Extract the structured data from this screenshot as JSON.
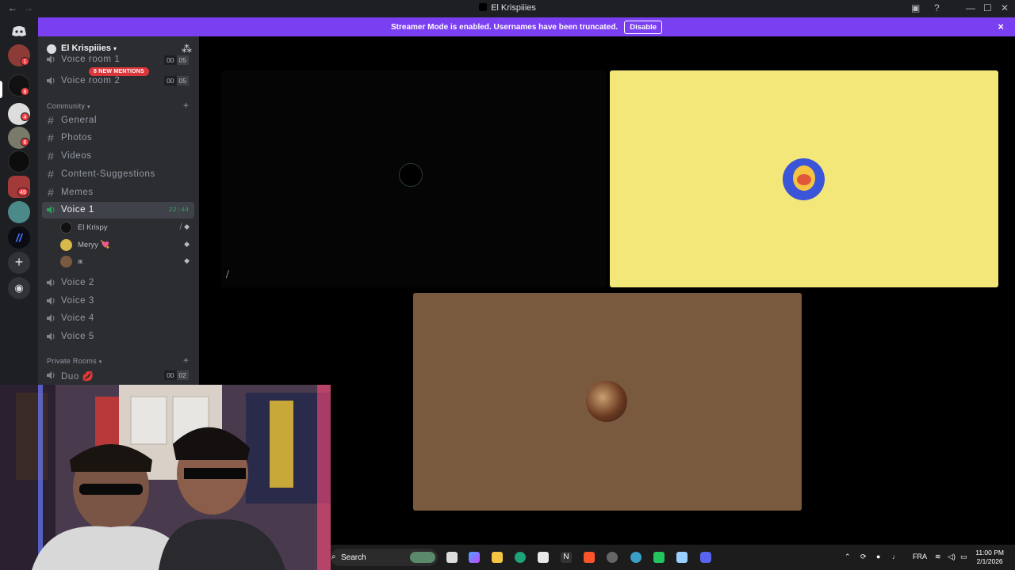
{
  "window": {
    "title": "El Krispiiies",
    "nav_back": "←",
    "nav_forward": "→"
  },
  "banner": {
    "text": "Streamer Mode is enabled. Usernames have been truncated.",
    "button": "Disable",
    "close": "×"
  },
  "server_rail": {
    "badges": [
      "1",
      "8",
      "4",
      "6",
      "49"
    ]
  },
  "guild": {
    "name": "El Krispiiies",
    "mentions_pill": "8 NEW MENTIONS"
  },
  "channels": {
    "voice_rooms": [
      {
        "label": "Voice room 1",
        "count_a": "00",
        "count_b": "05"
      },
      {
        "label": "Voice room 2",
        "count_a": "00",
        "count_b": "05"
      }
    ],
    "community_category": "Community",
    "text_channels": [
      "General",
      "Photos",
      "Videos",
      "Content-Suggestions",
      "Memes"
    ],
    "active_voice": {
      "label": "Voice 1",
      "time": "22:44"
    },
    "members": [
      {
        "name": "El Krispy"
      },
      {
        "name": "Meryy 💘"
      },
      {
        "name": "ж"
      }
    ],
    "voice_channels": [
      "Voice 2",
      "Voice 3",
      "Voice 4",
      "Voice 5"
    ],
    "private_category": "Private Rooms",
    "duo": {
      "label": "Duo 💋",
      "count_a": "00",
      "count_b": "02"
    }
  },
  "stage": {
    "tiles": [
      {
        "name": "el-krispy-tile",
        "bg": "#050505"
      },
      {
        "name": "meryy-tile",
        "bg": "#f3e77a"
      },
      {
        "name": "third-member-tile",
        "bg": "#7a5a3e"
      }
    ]
  },
  "taskbar": {
    "search_label": "Search",
    "lang": "FRA",
    "time": "11:00 PM",
    "date": "2/1/2026"
  },
  "colors": {
    "accent": "#7b3ff2",
    "online_green": "#23a55a",
    "mention_red": "#da373c"
  }
}
